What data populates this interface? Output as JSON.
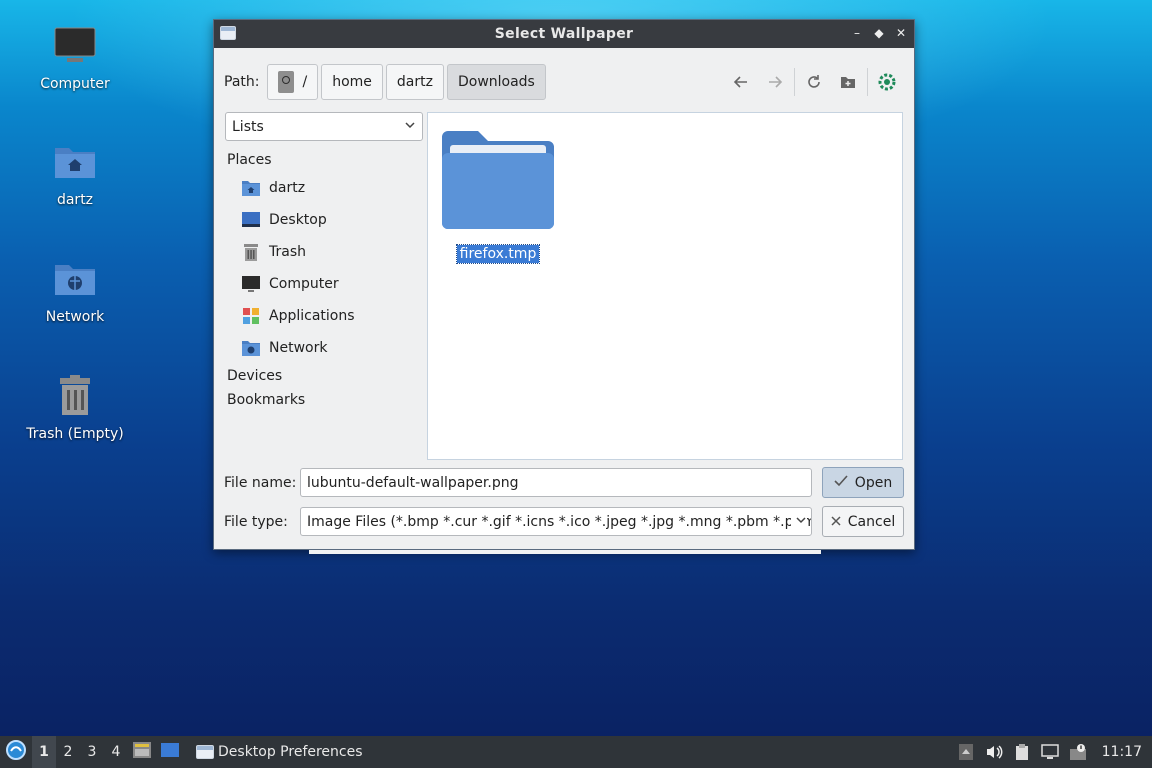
{
  "desktop": {
    "icons": [
      {
        "label": "Computer"
      },
      {
        "label": "dartz"
      },
      {
        "label": "Network"
      },
      {
        "label": "Trash (Empty)"
      }
    ]
  },
  "dialog": {
    "title": "Select Wallpaper",
    "window_controls": [
      "–",
      "◆",
      "✕"
    ],
    "path_label": "Path:",
    "breadcrumbs": [
      "/",
      "home",
      "dartz",
      "Downloads"
    ],
    "view_mode": "Lists",
    "places_header": "Places",
    "places": [
      "dartz",
      "Desktop",
      "Trash",
      "Computer",
      "Applications",
      "Network"
    ],
    "devices_header": "Devices",
    "bookmarks_header": "Bookmarks",
    "files": [
      {
        "name": "firefox.tmp"
      }
    ],
    "file_name_label": "File name:",
    "file_name_value": "lubuntu-default-wallpaper.png",
    "file_type_label": "File type:",
    "file_type_value": "Image Files (*.bmp *.cur *.gif *.icns *.ico *.jpeg *.jpg *.mng *.pbm *.pgm",
    "open_label": "Open",
    "cancel_label": "Cancel"
  },
  "taskbar": {
    "workspaces": [
      "1",
      "2",
      "3",
      "4"
    ],
    "active_workspace": "1",
    "task_label": "Desktop Preferences",
    "clock": "11:17"
  },
  "colors": {
    "accent": "#3a7bd5",
    "folder": "#5b93d8",
    "titlebar": "#383b40",
    "taskbar": "#2f3439"
  }
}
